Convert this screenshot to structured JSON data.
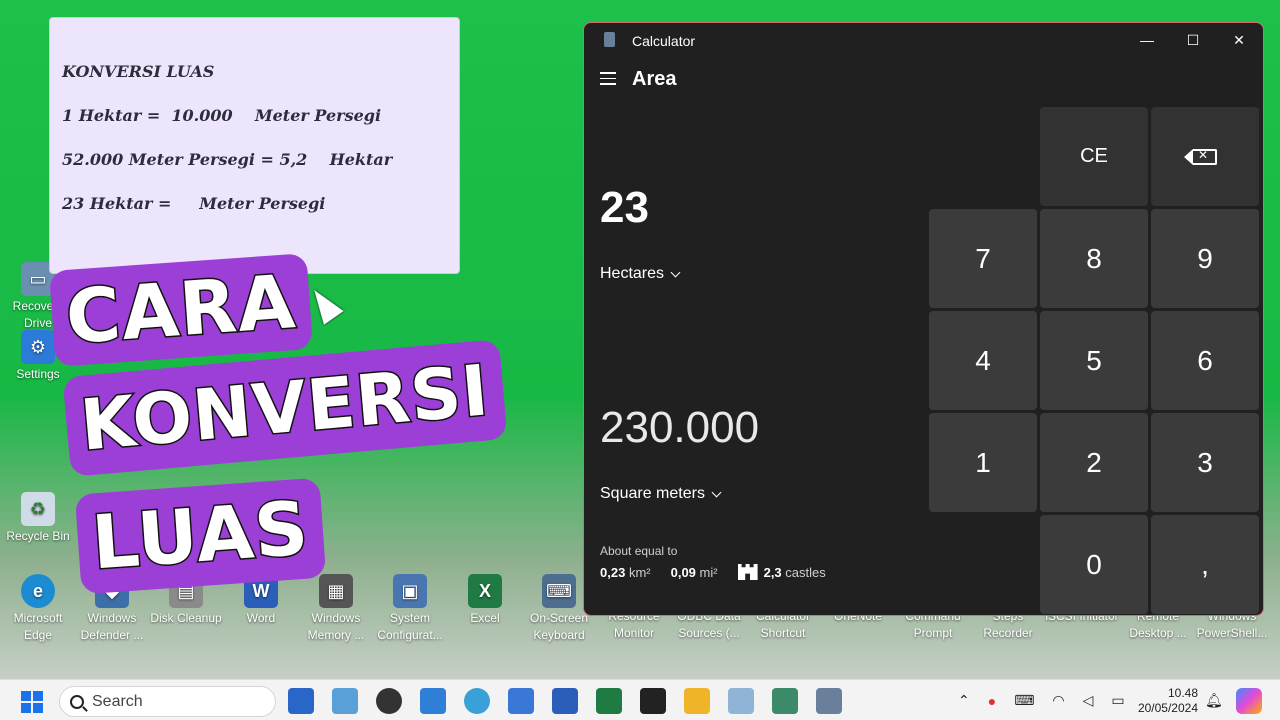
{
  "desktop": {
    "icons": [
      {
        "label": "Recovery Drive",
        "color": "#6b8fb0"
      },
      {
        "label": "Settings",
        "color": "#2d7bd8"
      },
      {
        "label": "Recycle Bin",
        "color": "#9fb6c8"
      },
      {
        "label": "Microsoft Edge",
        "color": "#1d8bd1"
      },
      {
        "label": "Windows Defender ...",
        "color": "#3c6ea8"
      },
      {
        "label": "Disk Cleanup",
        "color": "#8a8a8a"
      },
      {
        "label": "Word",
        "color": "#2b5eb8"
      },
      {
        "label": "Windows Memory ...",
        "color": "#555555"
      },
      {
        "label": "System Configurat...",
        "color": "#4a76b0"
      },
      {
        "label": "Excel",
        "color": "#1f7a43"
      },
      {
        "label": "On-Screen Keyboard",
        "color": "#4d6e8f"
      },
      {
        "label": "Resource Monitor",
        "color": "#666"
      },
      {
        "label": "ODBC Data Sources (...",
        "color": "#666"
      },
      {
        "label": "Calculator Shortcut",
        "color": "#666"
      },
      {
        "label": "OneNote",
        "color": "#666"
      },
      {
        "label": "Command Prompt",
        "color": "#666"
      },
      {
        "label": "Steps Recorder",
        "color": "#666"
      },
      {
        "label": "iSCSI Initiator",
        "color": "#666"
      },
      {
        "label": "Remote Desktop ...",
        "color": "#666"
      },
      {
        "label": "Windows PowerShell...",
        "color": "#666"
      }
    ]
  },
  "note": {
    "lines": [
      "KONVERSI LUAS",
      "1 Hektar =  10.000    Meter Persegi",
      "52.000 Meter Persegi = 5,2    Hektar",
      "23 Hektar =     Meter Persegi"
    ]
  },
  "overlay": {
    "word1": "CARA",
    "word2": "KONVERSI",
    "word3": "LUAS",
    "accent": "#9b3fd6"
  },
  "calculator": {
    "window_title": "Calculator",
    "mode": "Area",
    "from_value": "23",
    "from_unit": "Hectares",
    "to_value": "230.000",
    "to_unit": "Square meters",
    "about_label": "About equal to",
    "equivalents": [
      {
        "value": "0,23",
        "unit": "km²"
      },
      {
        "value": "0,09",
        "unit": "mi²"
      },
      {
        "value": "2,3",
        "unit": "castles",
        "icon": "castle-icon"
      }
    ],
    "keys": {
      "ce": "CE",
      "k7": "7",
      "k8": "8",
      "k9": "9",
      "k4": "4",
      "k5": "5",
      "k6": "6",
      "k1": "1",
      "k2": "2",
      "k3": "3",
      "k0": "0",
      "comma": ","
    },
    "controls": {
      "minimize": "—",
      "maximize": "☐",
      "close": "✕"
    }
  },
  "taskbar": {
    "search_placeholder": "Search",
    "time": "10.48",
    "date": "20/05/2024",
    "tray_icons": [
      "chevron-up-icon",
      "microphone-icon",
      "keyboard-icon",
      "wifi-icon",
      "speaker-icon",
      "battery-icon",
      "bell-icon",
      "copilot-icon"
    ]
  }
}
